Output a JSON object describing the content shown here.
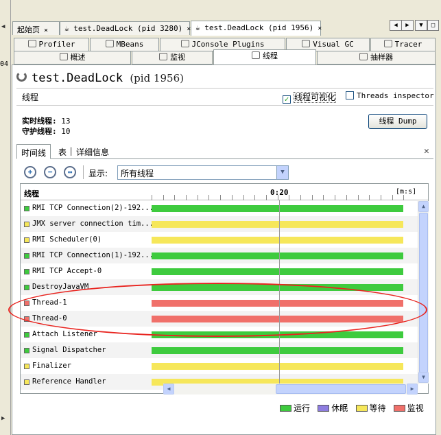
{
  "left_strip": {
    "number": "04"
  },
  "doc_tabs": [
    {
      "label": "起始页",
      "close": "×"
    },
    {
      "label": "test.DeadLock (pid 3280)",
      "close": "×"
    },
    {
      "label": "test.DeadLock (pid 1956)",
      "close": "×"
    }
  ],
  "tool_tabs_row1": [
    "Profiler",
    "MBeans",
    "JConsole Plugins",
    "Visual GC",
    "Tracer"
  ],
  "tool_tabs_row2": [
    "概述",
    "监视",
    "线程",
    "抽样器"
  ],
  "app": {
    "name": "test.DeadLock",
    "pid": "(pid 1956)"
  },
  "section": {
    "title": "线程",
    "visualize_label": "线程可视化",
    "inspector_label": "Threads inspector",
    "live_label": "实时线程:",
    "live_value": "13",
    "daemon_label": "守护线程:",
    "daemon_value": "10",
    "dump_button": "线程 Dump"
  },
  "subtabs": [
    "时间线",
    "表",
    "详细信息"
  ],
  "subtabs_sep": "|",
  "toolbar": {
    "show_label": "显示:",
    "filter_value": "所有线程"
  },
  "timeline": {
    "header_label": "线程",
    "time_mark": "0:20",
    "unit": "[m:s]"
  },
  "threads": [
    {
      "name": "RMI TCP Connection(2)-192...",
      "state": "running"
    },
    {
      "name": "JMX server connection tim...",
      "state": "waiting"
    },
    {
      "name": "RMI Scheduler(0)",
      "state": "waiting"
    },
    {
      "name": "RMI TCP Connection(1)-192...",
      "state": "running"
    },
    {
      "name": "RMI TCP Accept-0",
      "state": "running"
    },
    {
      "name": "DestroyJavaVM",
      "state": "running"
    },
    {
      "name": "Thread-1",
      "state": "monitor"
    },
    {
      "name": "Thread-0",
      "state": "monitor"
    },
    {
      "name": "Attach Listener",
      "state": "running"
    },
    {
      "name": "Signal Dispatcher",
      "state": "running"
    },
    {
      "name": "Finalizer",
      "state": "waiting"
    },
    {
      "name": "Reference Handler",
      "state": "waiting"
    }
  ],
  "legend": {
    "running": "运行",
    "sleeping": "休眠",
    "waiting": "等待",
    "monitor": "监视"
  },
  "colors": {
    "running": "#3ecb3e",
    "sleeping": "#8e7de0",
    "waiting": "#f6e75a",
    "monitor": "#f0706a",
    "annotation": "#e8241f"
  }
}
